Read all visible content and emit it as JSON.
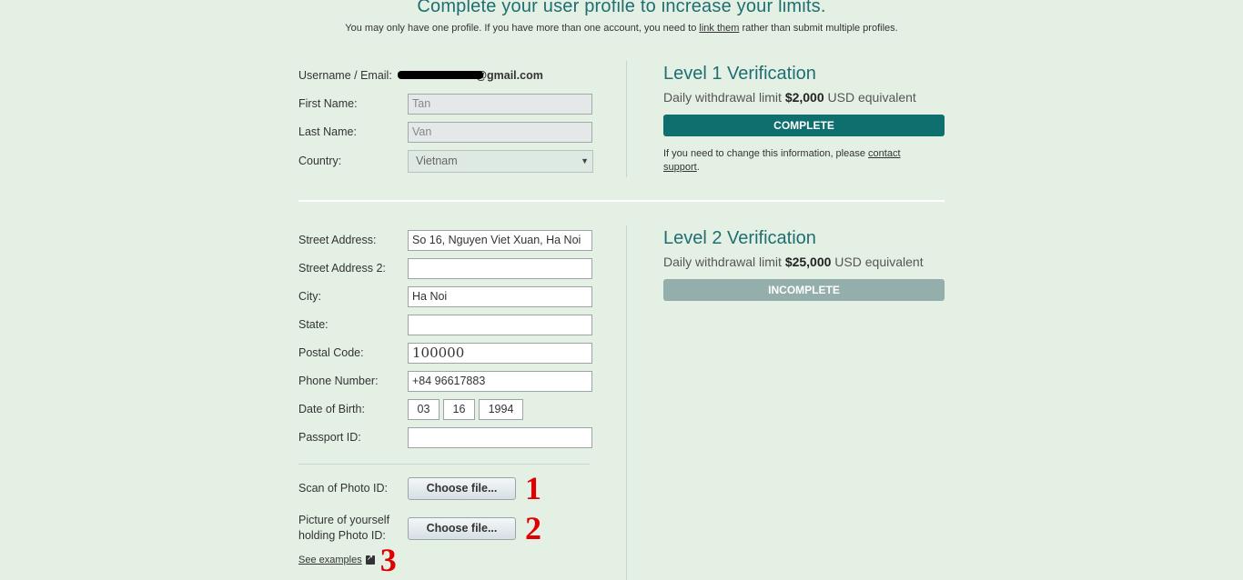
{
  "header": {
    "title": "Complete your user profile to increase your limits.",
    "subtitle_pre": "You may only have one profile. If you have more than one account, you need to ",
    "subtitle_link": "link them",
    "subtitle_post": " rather than submit multiple profiles."
  },
  "level1_form": {
    "username_label": "Username / Email:",
    "username_value": "@gmail.com",
    "first_name_label": "First Name:",
    "first_name_value": "Tan",
    "last_name_label": "Last Name:",
    "last_name_value": "Van",
    "country_label": "Country:",
    "country_value": "Vietnam"
  },
  "level1": {
    "title": "Level 1 Verification",
    "limit_pre": "Daily withdrawal limit ",
    "limit_amount": "$2,000",
    "limit_post": " USD equivalent",
    "status": "COMPLETE",
    "note_pre": "If you need to change this information, please ",
    "note_link": "contact support",
    "note_post": "."
  },
  "level2_form": {
    "street_label": "Street Address:",
    "street_value": "So 16, Nguyen Viet Xuan, Ha Noi",
    "street2_label": "Street Address 2:",
    "street2_value": "",
    "city_label": "City:",
    "city_value": "Ha Noi",
    "state_label": "State:",
    "state_value": "",
    "postal_label": "Postal Code:",
    "postal_value": "100000",
    "phone_label": "Phone Number:",
    "phone_value": "+84 96617883",
    "dob_label": "Date of Birth:",
    "dob_month": "03",
    "dob_day": "16",
    "dob_year": "1994",
    "passport_label": "Passport ID:",
    "passport_value": "",
    "scan_label": "Scan of Photo ID:",
    "picture_label_1": "Picture of yourself",
    "picture_label_2": "holding Photo ID:",
    "choose_file": "Choose file...",
    "see_examples": "See examples",
    "marker_1": "1",
    "marker_2": "2",
    "marker_3": "3"
  },
  "level2": {
    "title": "Level 2 Verification",
    "limit_pre": "Daily withdrawal limit ",
    "limit_amount": "$25,000",
    "limit_post": " USD equivalent",
    "status": "INCOMPLETE"
  },
  "colors": {
    "accent": "#1e6e72",
    "complete": "#0f6e6e",
    "incomplete": "#93aeab",
    "background": "#e5f0e5",
    "marker": "#e00000"
  },
  "icons": {
    "external_link": "external-link-icon",
    "dropdown": "chevron-down-icon"
  }
}
